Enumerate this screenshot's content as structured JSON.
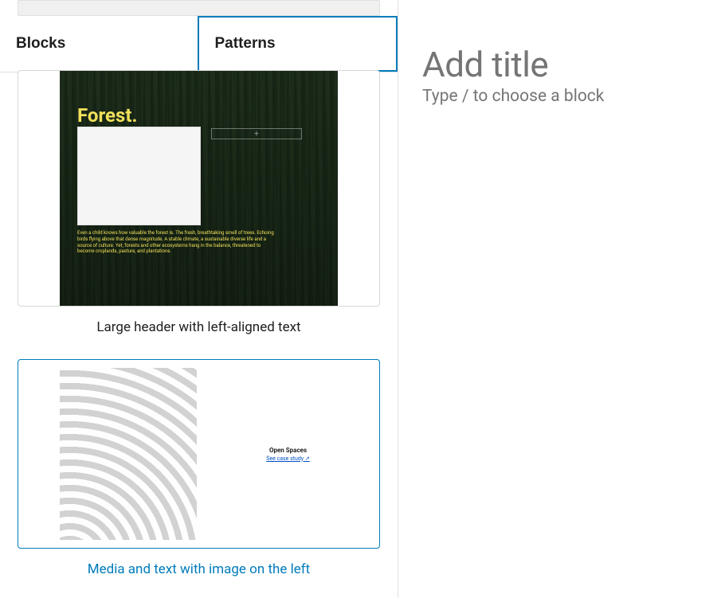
{
  "tabs": {
    "blocks": "Blocks",
    "patterns": "Patterns"
  },
  "patterns": [
    {
      "preview": {
        "title": "Forest.",
        "add_placeholder": "+",
        "paragraph": "Even a child knows how valuable the forest is. The fresh, breathtaking smell of trees. Echoing birds flying above that dense magnitude. A stable climate, a sustainable diverse life and a source of culture. Yet, forests and other ecosystems hang in the balance, threatened to become croplands, pasture, and plantations."
      },
      "label": "Large header with left-aligned text"
    },
    {
      "preview": {
        "heading": "Open Spaces",
        "link": "See case study ↗"
      },
      "label": "Media and text with image on the left"
    }
  ],
  "editor": {
    "title_placeholder": "Add title",
    "block_prompt": "Type / to choose a block"
  }
}
